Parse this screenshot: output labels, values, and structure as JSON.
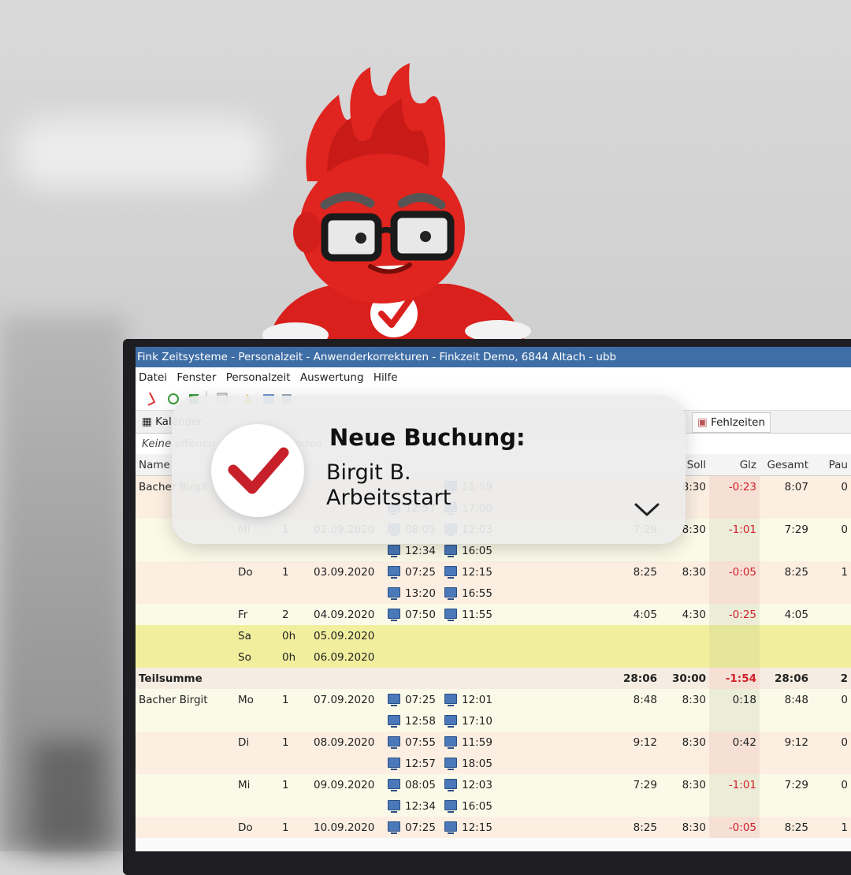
{
  "window": {
    "title": "Fink Zeitsysteme - Personalzeit - Anwenderkorrekturen - Finkzeit Demo, 6844 Altach - ubb"
  },
  "menu": [
    "Datei",
    "Fenster",
    "Personalzeit",
    "Auswertung",
    "Hilfe"
  ],
  "tabs": {
    "kalender": "Kalender",
    "fehlzeiten": "Fehlzeiten"
  },
  "info_line": "Keine offenen Anträge vorhanden",
  "table": {
    "headers": {
      "name": "Name",
      "soll": "Soll",
      "glz": "Glz",
      "gesamt": "Gesamt",
      "pause": "Pau"
    },
    "rows": [
      {
        "type": "peach",
        "name": "Bacher Birgit",
        "day": "",
        "n": "",
        "date": "",
        "in": "",
        "out": "11:59",
        "ist": "",
        "soll": "8:30",
        "glz": "-0:23",
        "gesamt": "8:07",
        "pause": "0"
      },
      {
        "type": "peach",
        "name": "",
        "day": "",
        "n": "",
        "date": "",
        "in": "12:57",
        "out": "17:00",
        "ist": "",
        "soll": "",
        "glz": "",
        "gesamt": "",
        "pause": ""
      },
      {
        "type": "cream",
        "name": "",
        "day": "Mi",
        "n": "1",
        "date": "02.09.2020",
        "in": "08:05",
        "out": "12:03",
        "ist": "7:29",
        "soll": "8:30",
        "glz": "-1:01",
        "gesamt": "7:29",
        "pause": "0"
      },
      {
        "type": "cream",
        "name": "",
        "day": "",
        "n": "",
        "date": "",
        "in": "12:34",
        "out": "16:05",
        "ist": "",
        "soll": "",
        "glz": "",
        "gesamt": "",
        "pause": ""
      },
      {
        "type": "peach",
        "name": "",
        "day": "Do",
        "n": "1",
        "date": "03.09.2020",
        "in": "07:25",
        "out": "12:15",
        "ist": "8:25",
        "soll": "8:30",
        "glz": "-0:05",
        "gesamt": "8:25",
        "pause": "1"
      },
      {
        "type": "peach",
        "name": "",
        "day": "",
        "n": "",
        "date": "",
        "in": "13:20",
        "out": "16:55",
        "ist": "",
        "soll": "",
        "glz": "",
        "gesamt": "",
        "pause": ""
      },
      {
        "type": "cream",
        "name": "",
        "day": "Fr",
        "n": "2",
        "date": "04.09.2020",
        "in": "07:50",
        "out": "11:55",
        "ist": "4:05",
        "soll": "4:30",
        "glz": "-0:25",
        "gesamt": "4:05",
        "pause": ""
      },
      {
        "type": "yellow",
        "name": "",
        "day": "Sa",
        "n": "0h",
        "date": "05.09.2020",
        "in": "",
        "out": "",
        "ist": "",
        "soll": "",
        "glz": "",
        "gesamt": "",
        "pause": ""
      },
      {
        "type": "yellow",
        "name": "",
        "day": "So",
        "n": "0h",
        "date": "06.09.2020",
        "in": "",
        "out": "",
        "ist": "",
        "soll": "",
        "glz": "",
        "gesamt": "",
        "pause": ""
      },
      {
        "type": "sum",
        "name": "Teilsumme",
        "day": "",
        "n": "",
        "date": "",
        "in": "",
        "out": "",
        "ist": "28:06",
        "soll": "30:00",
        "glz": "-1:54",
        "gesamt": "28:06",
        "pause": "2"
      },
      {
        "type": "cream",
        "name": "Bacher Birgit",
        "day": "Mo",
        "n": "1",
        "date": "07.09.2020",
        "in": "07:25",
        "out": "12:01",
        "ist": "8:48",
        "soll": "8:30",
        "glz": "0:18",
        "gesamt": "8:48",
        "pause": "0"
      },
      {
        "type": "cream",
        "name": "",
        "day": "",
        "n": "",
        "date": "",
        "in": "12:58",
        "out": "17:10",
        "ist": "",
        "soll": "",
        "glz": "",
        "gesamt": "",
        "pause": ""
      },
      {
        "type": "peach",
        "name": "",
        "day": "Di",
        "n": "1",
        "date": "08.09.2020",
        "in": "07:55",
        "out": "11:59",
        "ist": "9:12",
        "soll": "8:30",
        "glz": "0:42",
        "gesamt": "9:12",
        "pause": "0"
      },
      {
        "type": "peach",
        "name": "",
        "day": "",
        "n": "",
        "date": "",
        "in": "12:57",
        "out": "18:05",
        "ist": "",
        "soll": "",
        "glz": "",
        "gesamt": "",
        "pause": ""
      },
      {
        "type": "cream",
        "name": "",
        "day": "Mi",
        "n": "1",
        "date": "09.09.2020",
        "in": "08:05",
        "out": "12:03",
        "ist": "7:29",
        "soll": "8:30",
        "glz": "-1:01",
        "gesamt": "7:29",
        "pause": "0"
      },
      {
        "type": "cream",
        "name": "",
        "day": "",
        "n": "",
        "date": "",
        "in": "12:34",
        "out": "16:05",
        "ist": "",
        "soll": "",
        "glz": "",
        "gesamt": "",
        "pause": ""
      },
      {
        "type": "peach",
        "name": "",
        "day": "Do",
        "n": "1",
        "date": "10.09.2020",
        "in": "07:25",
        "out": "12:15",
        "ist": "8:25",
        "soll": "8:30",
        "glz": "-0:05",
        "gesamt": "8:25",
        "pause": "1"
      }
    ]
  },
  "notification": {
    "title": "Neue Buchung:",
    "line1": "Birgit B.",
    "line2": "Arbeitsstart",
    "accent": "#c8202a"
  },
  "colors": {
    "title_bar": "#3f6ea6",
    "mascot": "#e0241f",
    "negative": "#d0202a"
  }
}
